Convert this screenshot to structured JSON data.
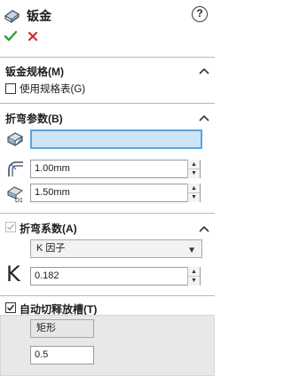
{
  "header": {
    "title": "钣金",
    "help_symbol": "?"
  },
  "sections": {
    "sheet_metal_gauges": {
      "title": "钣金规格(M)",
      "use_gauge_table_label": "使用规格表(G)",
      "use_gauge_table_checked": false
    },
    "bend_parameters": {
      "title": "折弯参数(B)",
      "face_selection_value": "",
      "radius_value": "1.00mm",
      "thickness_value": "1.50mm"
    },
    "bend_allowance": {
      "title": "折弯系数(A)",
      "checked": true,
      "type_value": "K 因子",
      "k_symbol": "K",
      "k_value": "0.182"
    },
    "auto_relief": {
      "title": "自动切释放槽(T)",
      "checked": true,
      "type_value": "矩形",
      "ratio_value": "0.5"
    }
  },
  "colors": {
    "ok_green": "#2e9e3a",
    "cancel_red": "#d42a2a",
    "selection_blue": "#cde4f7"
  }
}
